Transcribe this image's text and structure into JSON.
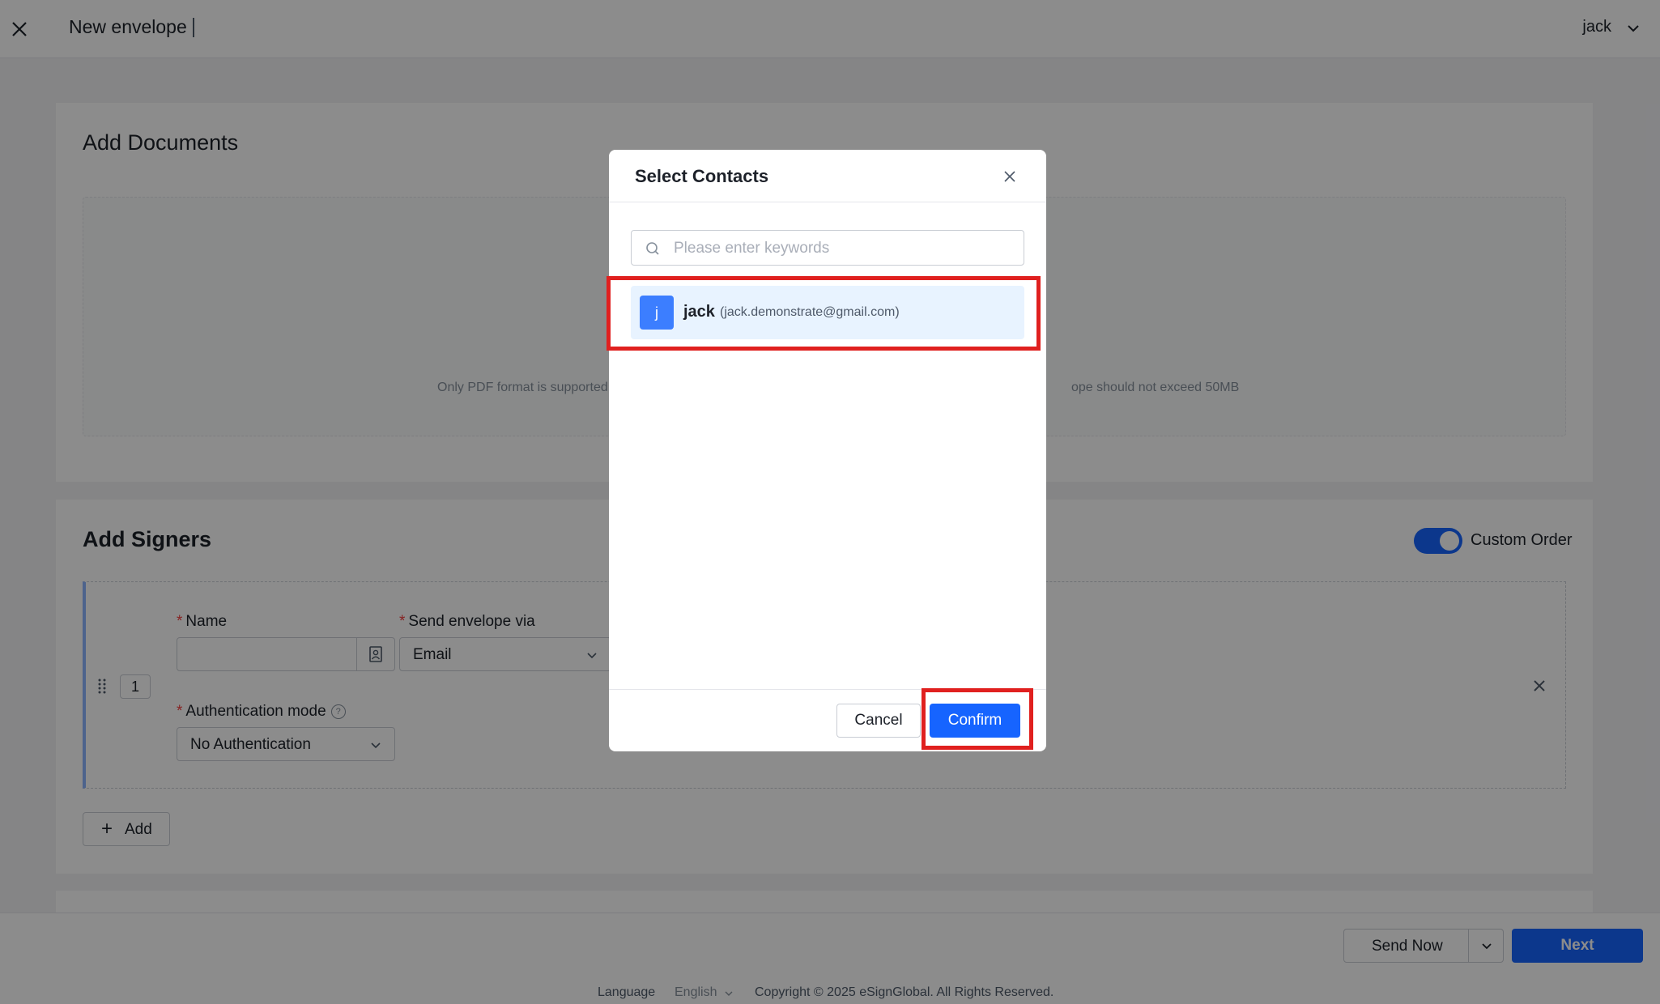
{
  "header": {
    "title": "New envelope",
    "user": "jack"
  },
  "documents": {
    "title": "Add Documents",
    "hint_left": "Only PDF format is supported",
    "hint_right": "ope should not exceed 50MB"
  },
  "signers": {
    "title": "Add Signers",
    "custom_order_label": "Custom Order",
    "custom_order_on": true,
    "order_number": "1",
    "name_label": "Name",
    "name_value": "",
    "send_via_label": "Send envelope via",
    "send_via_value": "Email",
    "auth_label": "Authentication mode",
    "auth_value": "No Authentication",
    "add_label": "Add",
    "required_mark": "*",
    "help_mark": "?"
  },
  "bottom_bar": {
    "send_now_label": "Send Now",
    "next_label": "Next"
  },
  "footer": {
    "language_label": "Language",
    "language_value": "English",
    "copyright": "Copyright © 2025 eSignGlobal. All Rights Reserved."
  },
  "modal": {
    "title": "Select Contacts",
    "search_placeholder": "Please enter keywords",
    "contacts": [
      {
        "initial": "j",
        "name": "jack",
        "email": "(jack.demonstrate@gmail.com)"
      }
    ],
    "cancel_label": "Cancel",
    "confirm_label": "Confirm"
  },
  "colors": {
    "primary": "#1664ff",
    "highlight": "#e0201f",
    "selected_row": "#e8f3ff",
    "avatar": "#3c7eff"
  }
}
